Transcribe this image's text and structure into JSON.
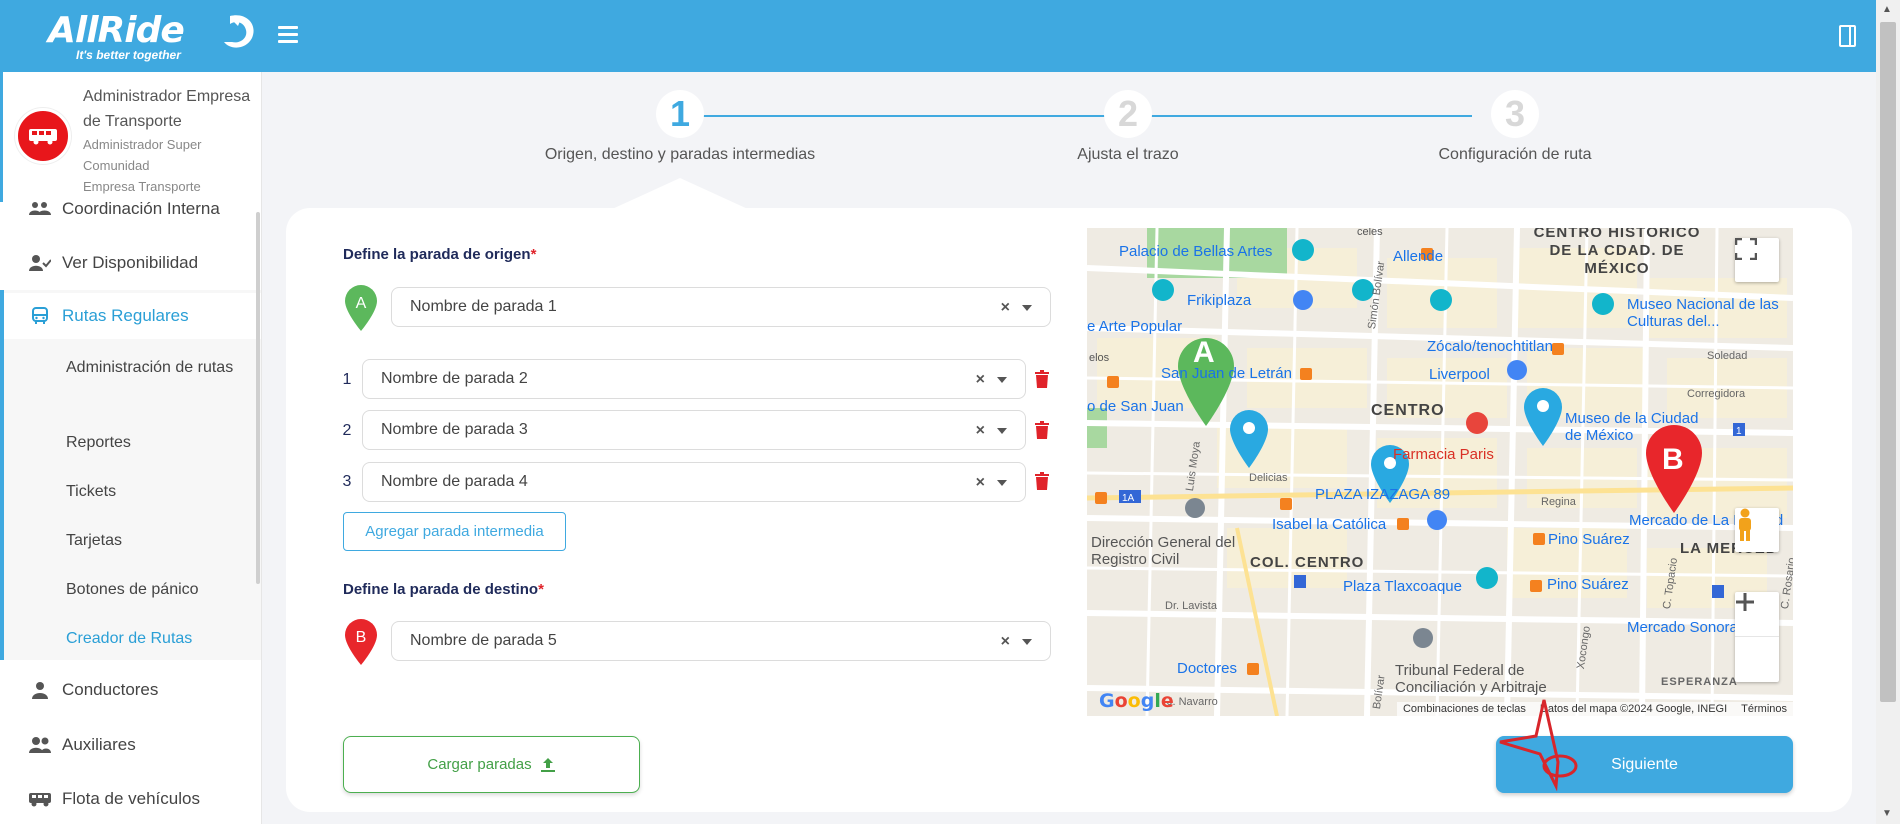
{
  "app": {
    "brand": "AllRide",
    "tagline": "It's better together"
  },
  "profile": {
    "name": "Administrador Empresa de Transporte",
    "role": "Administrador Super Comunidad",
    "company": "Empresa Transporte"
  },
  "sidebar": {
    "items": [
      {
        "label": "Coordinación Interna",
        "icon": "team-icon"
      },
      {
        "label": "Ver Disponibilidad",
        "icon": "user-check-icon"
      },
      {
        "label": "Rutas Regulares",
        "icon": "bus-icon",
        "active": true
      },
      {
        "label": "Conductores",
        "icon": "driver-icon"
      },
      {
        "label": "Auxiliares",
        "icon": "users-icon"
      },
      {
        "label": "Flota de vehículos",
        "icon": "van-icon"
      }
    ],
    "subitems": [
      "Administración de rutas",
      "Reportes",
      "Tickets",
      "Tarjetas",
      "Botones de pánico",
      "Creador de Rutas"
    ],
    "current_subitem": "Creador de Rutas"
  },
  "stepper": {
    "steps": [
      {
        "number": "1",
        "label": "Origen, destino y paradas intermedias",
        "active": true
      },
      {
        "number": "2",
        "label": "Ajusta el trazo",
        "active": false
      },
      {
        "number": "3",
        "label": "Configuración de ruta",
        "active": false
      }
    ]
  },
  "form": {
    "origin_title": "Define la parada de origen",
    "origin_marker": "A",
    "origin_value": "Nombre de parada 1",
    "intermediate": [
      {
        "index": "1",
        "value": "Nombre de parada 2"
      },
      {
        "index": "2",
        "value": "Nombre de parada 3"
      },
      {
        "index": "3",
        "value": "Nombre de parada 4"
      }
    ],
    "add_intermediate_label": "Agregar parada intermedia",
    "destination_title": "Define la parada de destino",
    "destination_marker": "B",
    "destination_value": "Nombre de parada 5",
    "required_mark": "*",
    "clear_symbol": "×",
    "load_stops_label": "Cargar paradas",
    "next_label": "Siguiente"
  },
  "map": {
    "labels": {
      "palacio": "Palacio de Bellas Artes",
      "allende": "Allende",
      "centro_historico": "CENTRO HISTÓRICO DE LA CDAD. DE MÉXICO",
      "frikiplaza": "Frikiplaza",
      "arte_popular": "e Arte Popular",
      "museo_culturas": "Museo Nacional de las Culturas del...",
      "zocalo": "Zócalo/tenochtitlan",
      "letran": "San Juan de Letrán",
      "san_juan": "o de San Juan",
      "liverpool": "Liverpool",
      "centro": "CENTRO",
      "museo_ciudad": "Museo de la Ciudad de México",
      "farmacia": "Farmacia Paris",
      "plaza_izazaga": "PLAZA IZAZAGA 89",
      "isabel": "Isabel la Católica",
      "mercado_merced": "Mercado de La Merced",
      "pino1": "Pino Suárez",
      "direccion": "Dirección General del Registro Civil",
      "col_centro": "COL. CENTRO",
      "la_merced": "LA MERCED",
      "plaza_tlax": "Plaza Tlaxcoaque",
      "pino2": "Pino Suárez",
      "mercado_sonora": "Mercado Sonora",
      "doctores": "Doctores",
      "tribunal": "Tribunal Federal de Conciliación y Arbitraje",
      "esperanza": "ESPERANZA",
      "soledad": "Soledad",
      "corregidora": "Corregidora",
      "regina": "Regina",
      "delicias": "Delicias",
      "lavista": "Dr. Lavista",
      "navarro": "J. Navarro",
      "topacio": "C. Topacio",
      "xocongo": "Xocongo",
      "bolivar": "Simón Bolívar",
      "luis_moya": "Luis Moya",
      "rosario": "C. Rosario",
      "bolivar2": "Bolívar",
      "conceles": "celes"
    },
    "marker_a": "A",
    "marker_b": "B",
    "google": "Google",
    "footer": [
      "Combinaciones de teclas",
      "Datos del mapa ©2024 Google, INEGI",
      "Términos"
    ],
    "road_1a": "1A",
    "road_1": "1"
  },
  "colors": {
    "primary": "#3fa9e0",
    "marker_a": "#5cb85c",
    "marker_b": "#e8262b",
    "danger": "#e0232a"
  }
}
